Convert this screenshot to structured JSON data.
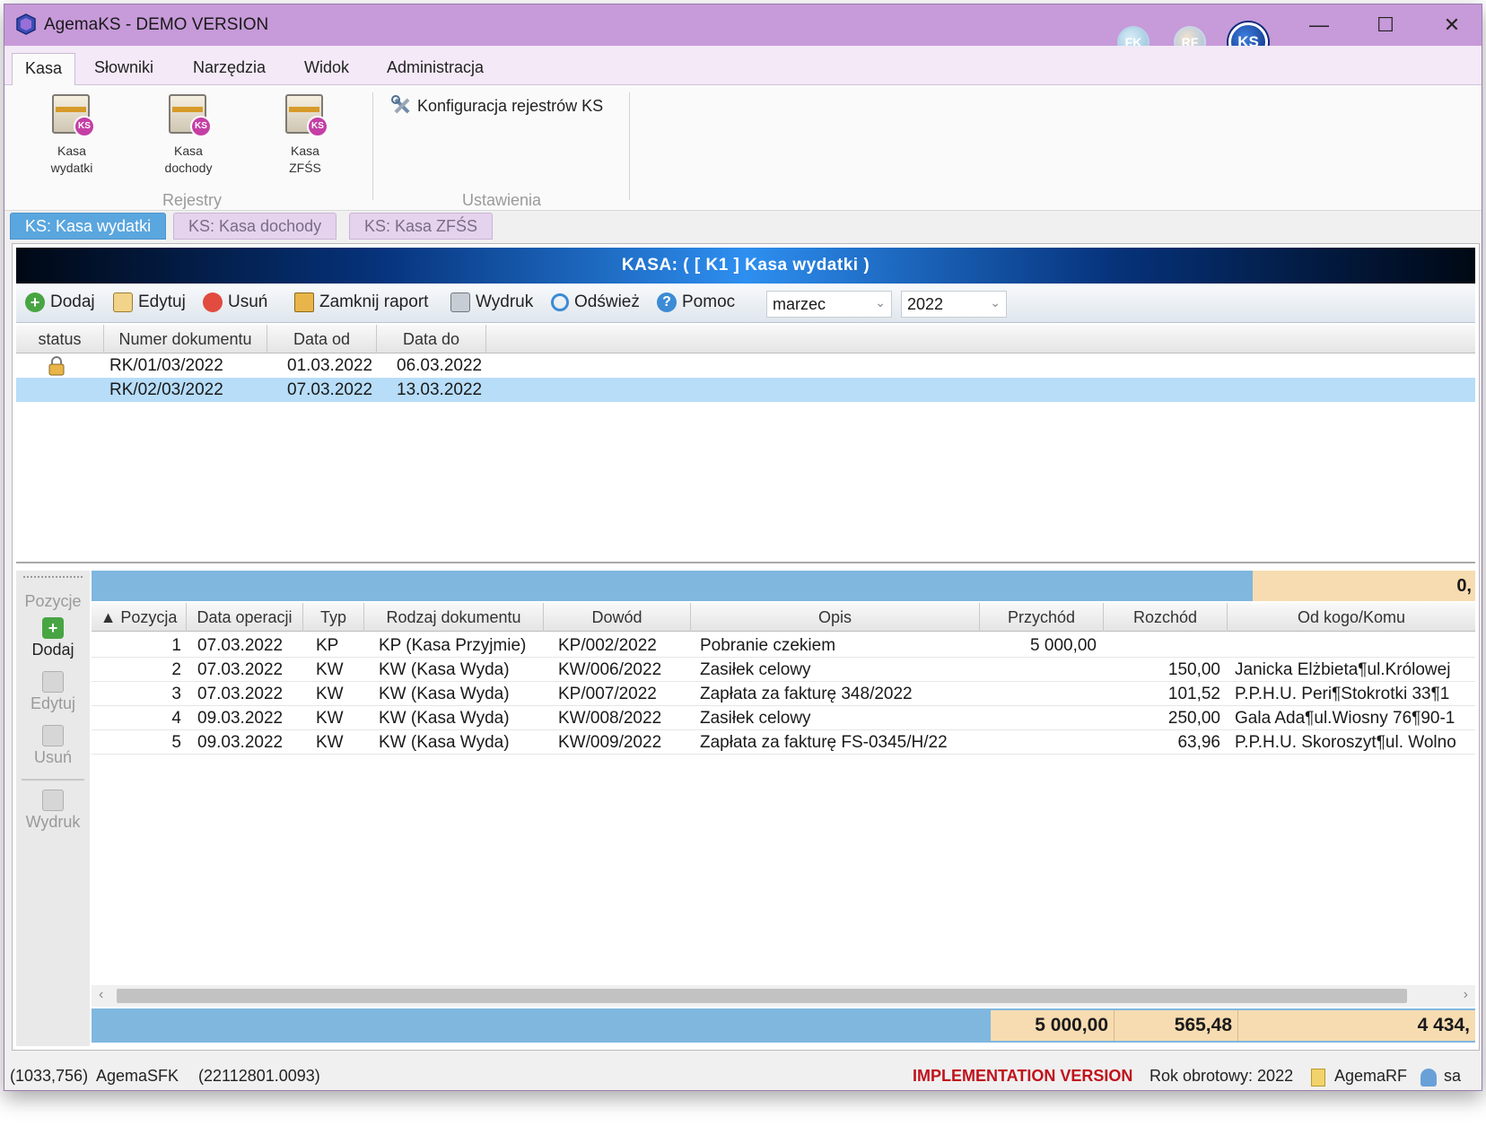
{
  "window": {
    "title": "AgemaKS - DEMO VERSION",
    "modules": [
      "FK",
      "RF",
      "KS"
    ]
  },
  "menu": {
    "tabs": [
      "Kasa",
      "Słowniki",
      "Narzędzia",
      "Widok",
      "Administracja"
    ]
  },
  "ribbon": {
    "buttons": [
      {
        "line1": "Kasa",
        "line2": "wydatki"
      },
      {
        "line1": "Kasa",
        "line2": "dochody"
      },
      {
        "line1": "Kasa",
        "line2": "ZFŚS"
      }
    ],
    "badge": "KS",
    "group_rejestry": "Rejestry",
    "config_link": "Konfiguracja rejestrów KS",
    "group_ustawienia": "Ustawienia"
  },
  "doc_tabs": [
    "KS: Kasa wydatki",
    "KS: Kasa dochody",
    "KS: Kasa ZFŚS"
  ],
  "header": {
    "title": "KASA:   ( [ K1 ] Kasa wydatki )"
  },
  "toolbar": {
    "add": "Dodaj",
    "edit": "Edytuj",
    "delete": "Usuń",
    "close_report": "Zamknij raport",
    "print": "Wydruk",
    "refresh": "Odśwież",
    "help": "Pomoc",
    "month": "marzec",
    "year": "2022"
  },
  "reports": {
    "columns": [
      "status",
      "Numer dokumentu",
      "Data od",
      "Data do"
    ],
    "rows": [
      {
        "locked": true,
        "number": "RK/01/03/2022",
        "from": "01.03.2022",
        "to": "06.03.2022"
      },
      {
        "locked": false,
        "number": "RK/02/03/2022",
        "from": "07.03.2022",
        "to": "13.03.2022"
      }
    ]
  },
  "positions_panel": {
    "title": "Pozycje",
    "add": "Dodaj",
    "edit": "Edytuj",
    "delete": "Usuń",
    "print": "Wydruk"
  },
  "positions": {
    "top_total": "0,",
    "columns": [
      "▲ Pozycja",
      "Data operacji",
      "Typ",
      "Rodzaj dokumentu",
      "Dowód",
      "Opis",
      "Przychód",
      "Rozchód",
      "Od kogo/Komu"
    ],
    "rows": [
      {
        "pos": "1",
        "date": "07.03.2022",
        "type": "KP",
        "kind": "KP (Kasa Przyjmie)",
        "proof": "KP/002/2022",
        "desc": "Pobranie czekiem",
        "income": "5 000,00",
        "expense": "",
        "party": ""
      },
      {
        "pos": "2",
        "date": "07.03.2022",
        "type": "KW",
        "kind": "KW (Kasa Wyda)",
        "proof": "KW/006/2022",
        "desc": "Zasiłek celowy",
        "income": "",
        "expense": "150,00",
        "party": "Janicka Elżbieta¶ul.Królowej"
      },
      {
        "pos": "3",
        "date": "07.03.2022",
        "type": "KW",
        "kind": "KW (Kasa Wyda)",
        "proof": "KP/007/2022",
        "desc": "Zapłata za fakturę 348/2022",
        "income": "",
        "expense": "101,52",
        "party": "P.P.H.U. Peri¶Stokrotki 33¶1"
      },
      {
        "pos": "4",
        "date": "09.03.2022",
        "type": "KW",
        "kind": "KW (Kasa Wyda)",
        "proof": "KW/008/2022",
        "desc": "Zasiłek celowy",
        "income": "",
        "expense": "250,00",
        "party": "Gala Ada¶ul.Wiosny 76¶90-1"
      },
      {
        "pos": "5",
        "date": "09.03.2022",
        "type": "KW",
        "kind": "KW (Kasa Wyda)",
        "proof": "KW/009/2022",
        "desc": "Zapłata za fakturę FS-0345/H/22",
        "income": "",
        "expense": "63,96",
        "party": "P.P.H.U. Skoroszyt¶ul. Wolno"
      }
    ],
    "totals": {
      "income": "5 000,00",
      "expense": "565,48",
      "balance": "4 434,"
    }
  },
  "status": {
    "coords": "(1033,756)",
    "app": "AgemaSFK",
    "build": "(22112801.0093)",
    "impl": "IMPLEMENTATION VERSION",
    "year": "Rok obrotowy: 2022",
    "db": "AgemaRF",
    "user": "sa"
  }
}
